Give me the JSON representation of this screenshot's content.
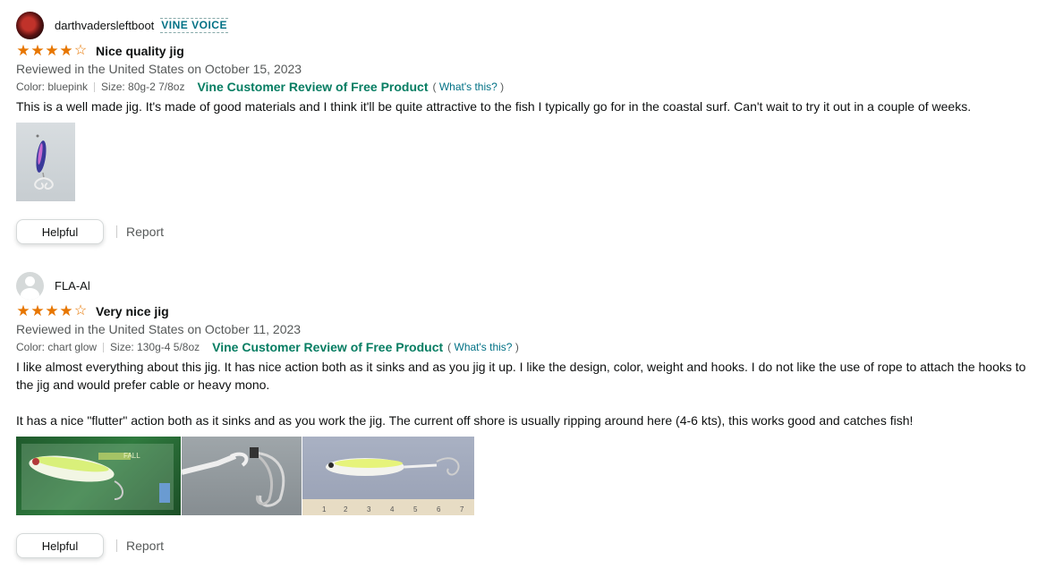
{
  "reviews": [
    {
      "author": "darthvadersleftboot",
      "badge": "VINE VOICE",
      "rating": 4,
      "title": "Nice quality jig",
      "date": "Reviewed in the United States on October 15, 2023",
      "color": "Color: bluepink",
      "size": "Size: 80g-2 7/8oz",
      "vine_label": "Vine Customer Review of Free Product",
      "whats_this": "What's this?",
      "body": [
        "This is a well made jig. It's made of good materials and I think it'll be quite attractive to the fish I typically go for in the coastal surf. Can't wait to try it out in a couple of weeks."
      ],
      "image_count": 1,
      "helpful_label": "Helpful",
      "report_label": "Report"
    },
    {
      "author": "FLA-Al",
      "badge": "",
      "rating": 4,
      "title": "Very nice jig",
      "date": "Reviewed in the United States on October 11, 2023",
      "color": "Color: chart glow",
      "size": "Size: 130g-4 5/8oz",
      "vine_label": "Vine Customer Review of Free Product",
      "whats_this": "What's this?",
      "body": [
        "I like almost everything about this jig. It has nice action both as it sinks and as you jig it up. I like the design, color, weight and hooks. I do not like the use of rope to attach the hooks to the jig and would prefer cable or heavy mono.",
        "It has a nice \"flutter\" action both as it sinks and as you work the jig. The current off shore is usually ripping around here (4-6 kts), this works good and catches fish!"
      ],
      "image_count": 3,
      "package_text": "FALL",
      "ruler_numbers": [
        "1",
        "2",
        "3",
        "4",
        "5",
        "6",
        "7"
      ],
      "helpful_label": "Helpful",
      "report_label": "Report"
    }
  ],
  "colors": {
    "star": "#e77600",
    "link": "#007185",
    "vine": "#067d62"
  }
}
